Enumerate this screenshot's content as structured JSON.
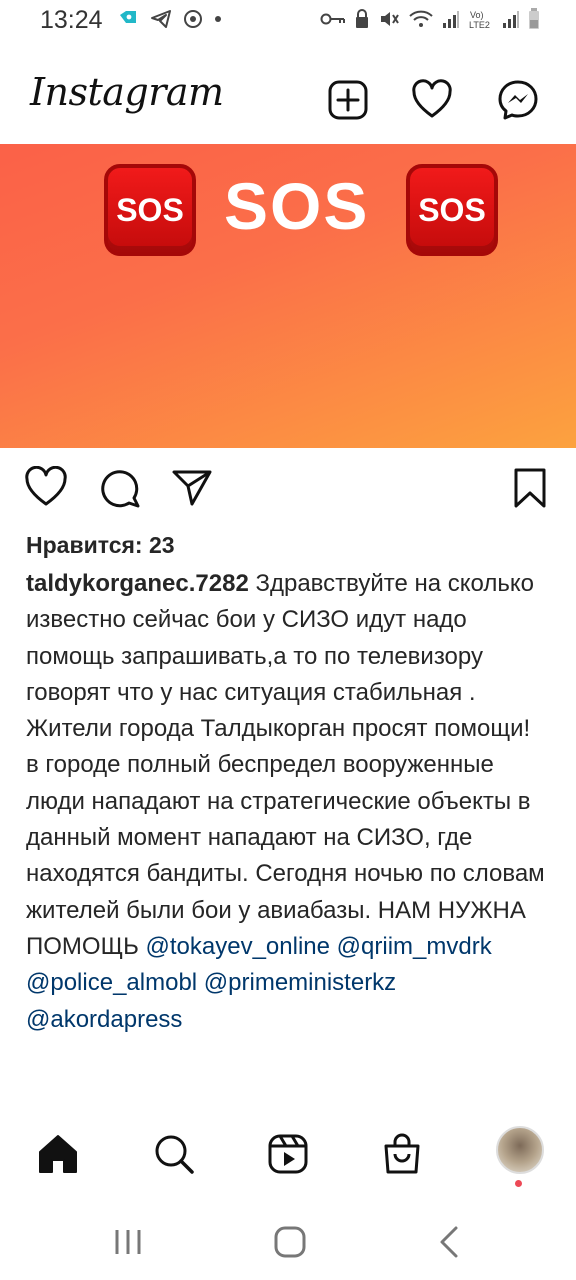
{
  "status_bar": {
    "time": "13:24"
  },
  "header": {
    "logo": "Instagram",
    "icons": [
      "new-post-icon",
      "heart-icon",
      "messenger-icon"
    ]
  },
  "post": {
    "image": {
      "badge_left": "SOS",
      "center_text": "SOS",
      "badge_right": "SOS",
      "gradient": [
        "#fb6148",
        "#fca23f"
      ]
    },
    "likes": "Нравится: 23",
    "caption": {
      "username": "taldykorganec.7282",
      "text": "Здравствуйте на сколько известно сейчас бои у СИЗО идут надо помощь запрашивать,а то по телевизору говорят что у нас ситуация стабильная .",
      "text2": "Жители города Талдыкорган просят помощи! в городе полный беспредел вооруженные люди нападают на стратегические объекты в данный момент нападают на СИЗО, где находятся бандиты. Сегодня ночью по словам жителей были бои у авиабазы. НАМ НУЖНА ПОМОЩЬ",
      "mentions": [
        "@tokayev_online",
        "@qriim_mvdrk",
        "@police_almobl",
        "@primeministerkz",
        "@akordapress"
      ]
    }
  },
  "bottom_nav": {
    "items": [
      "home-icon",
      "search-icon",
      "reels-icon",
      "shop-icon",
      "profile-avatar"
    ]
  },
  "system_nav": {
    "items": [
      "recent-apps",
      "home",
      "back"
    ]
  },
  "colors": {
    "mention": "#00376b",
    "notification_dot": "#ed4956",
    "sos_red": "#e31414"
  }
}
